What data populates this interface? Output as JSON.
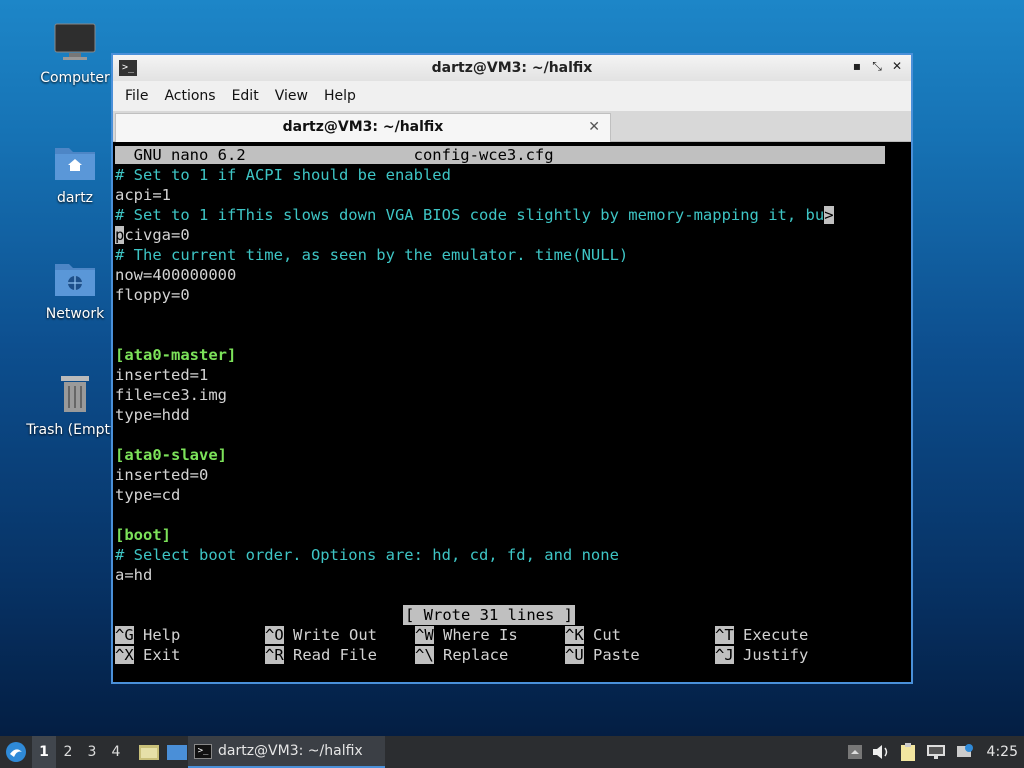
{
  "desktop_icons": [
    {
      "label": "Computer"
    },
    {
      "label": "dartz"
    },
    {
      "label": "Network"
    },
    {
      "label": "Trash (Empty)"
    }
  ],
  "window": {
    "title": "dartz@VM3: ~/halfix",
    "controls": {
      "minimize": "▪",
      "maximize": "⤡",
      "close": "✕"
    }
  },
  "menu": {
    "file": "File",
    "actions": "Actions",
    "edit": "Edit",
    "view": "View",
    "help": "Help"
  },
  "tab": {
    "label": "dartz@VM3: ~/halfix",
    "close": "✕"
  },
  "editor": {
    "header": "  GNU nano 6.2                  config-wce3.cfg",
    "lines": [
      "# Set to 1 if ACPI should be enabled",
      "acpi=1",
      "# Set to 1 ifThis slows down VGA BIOS code slightly by memory-mapping it, bu",
      "civga=0",
      "# The current time, as seen by the emulator. time(NULL)",
      "now=400000000",
      "floppy=0",
      "[ata0-master]",
      "inserted=1",
      "file=ce3.img",
      "type=hdd",
      "[ata0-slave]",
      "inserted=0",
      "type=cd",
      "[boot]",
      "# Select boot order. Options are: hd, cd, fd, and none",
      "a=hd"
    ],
    "overflow_marker": ">",
    "cursor_char": "p",
    "status": "[ Wrote 31 lines ]",
    "shortcuts": [
      {
        "key": "^G",
        "label": "Help"
      },
      {
        "key": "^O",
        "label": "Write Out"
      },
      {
        "key": "^W",
        "label": "Where Is"
      },
      {
        "key": "^K",
        "label": "Cut"
      },
      {
        "key": "^T",
        "label": "Execute"
      },
      {
        "key": "^X",
        "label": "Exit"
      },
      {
        "key": "^R",
        "label": "Read File"
      },
      {
        "key": "^\\",
        "label": "Replace"
      },
      {
        "key": "^U",
        "label": "Paste"
      },
      {
        "key": "^J",
        "label": "Justify"
      }
    ]
  },
  "taskbar": {
    "workspaces": [
      "1",
      "2",
      "3",
      "4"
    ],
    "active_task": "dartz@VM3: ~/halfix",
    "clock": "4:25"
  }
}
